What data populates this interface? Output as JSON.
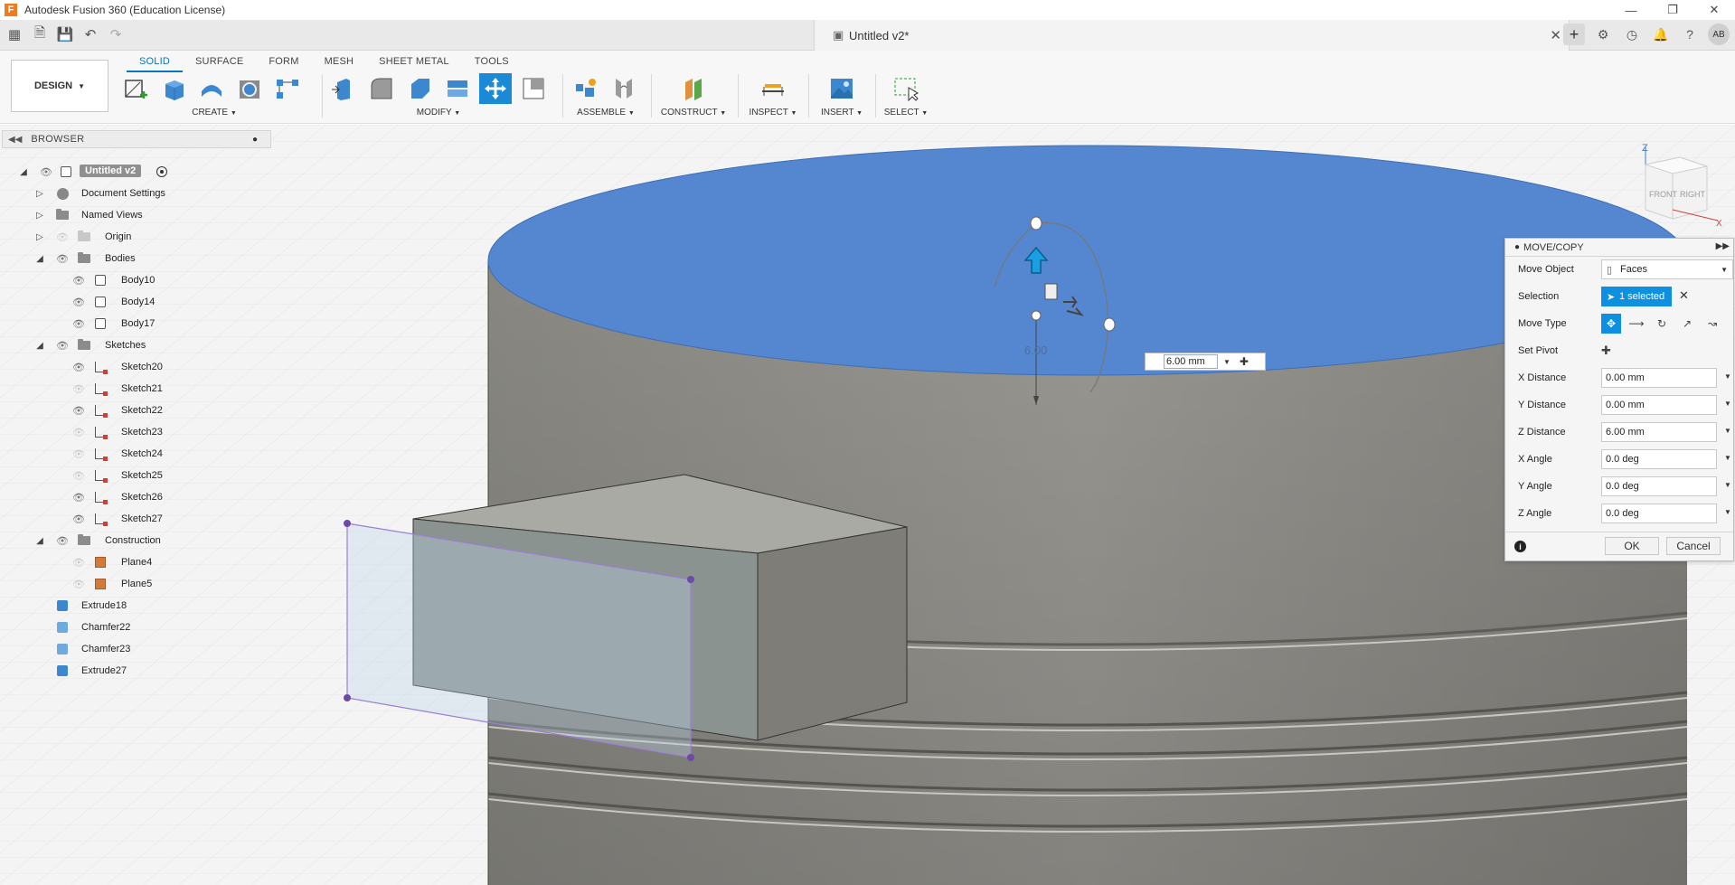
{
  "window": {
    "title": "Autodesk Fusion 360 (Education License)",
    "app_icon_letter": "F",
    "controls": [
      "minimize",
      "restore",
      "close"
    ]
  },
  "appbar": {
    "document_title": "Untitled v2*",
    "avatar_initials": "AB"
  },
  "toolbar": {
    "workspace": "DESIGN",
    "tabs": [
      "SOLID",
      "SURFACE",
      "FORM",
      "MESH",
      "SHEET METAL",
      "TOOLS"
    ],
    "active_tab": "SOLID",
    "groups": {
      "create": "CREATE",
      "modify": "MODIFY",
      "assemble": "ASSEMBLE",
      "construct": "CONSTRUCT",
      "inspect": "INSPECT",
      "insert": "INSERT",
      "select": "SELECT"
    }
  },
  "browser": {
    "title": "BROWSER",
    "root": "Untitled v2",
    "items": {
      "document_settings": "Document Settings",
      "named_views": "Named Views",
      "origin": "Origin",
      "bodies": "Bodies",
      "body10": "Body10",
      "body14": "Body14",
      "body17": "Body17",
      "sketches": "Sketches",
      "sketch20": "Sketch20",
      "sketch21": "Sketch21",
      "sketch22": "Sketch22",
      "sketch23": "Sketch23",
      "sketch24": "Sketch24",
      "sketch25": "Sketch25",
      "sketch26": "Sketch26",
      "sketch27": "Sketch27",
      "construction": "Construction",
      "plane4": "Plane4",
      "plane5": "Plane5",
      "extrude18": "Extrude18",
      "chamfer22": "Chamfer22",
      "chamfer23": "Chamfer23",
      "extrude27": "Extrude27"
    }
  },
  "viewport": {
    "distance_marker": "6.00",
    "canvas_input_value": "6.00 mm",
    "viewcube": {
      "front": "FRONT",
      "right": "RIGHT",
      "axis_z": "Z",
      "axis_x": "X"
    }
  },
  "dialog": {
    "title": "MOVE/COPY",
    "move_object_label": "Move Object",
    "move_object_value": "Faces",
    "selection_label": "Selection",
    "selection_value": "1 selected",
    "move_type_label": "Move Type",
    "set_pivot_label": "Set Pivot",
    "x_distance_label": "X Distance",
    "x_distance_value": "0.00 mm",
    "y_distance_label": "Y Distance",
    "y_distance_value": "0.00 mm",
    "z_distance_label": "Z Distance",
    "z_distance_value": "6.00 mm",
    "x_angle_label": "X Angle",
    "x_angle_value": "0.0 deg",
    "y_angle_label": "Y Angle",
    "y_angle_value": "0.0 deg",
    "z_angle_label": "Z Angle",
    "z_angle_value": "0.0 deg",
    "ok_label": "OK",
    "cancel_label": "Cancel"
  },
  "colors": {
    "accent_blue": "#0e8fe0",
    "selected_face": "#5487cf",
    "cylinder_gray": "#9a9a94",
    "sketch_purple": "#9b7fd4"
  }
}
